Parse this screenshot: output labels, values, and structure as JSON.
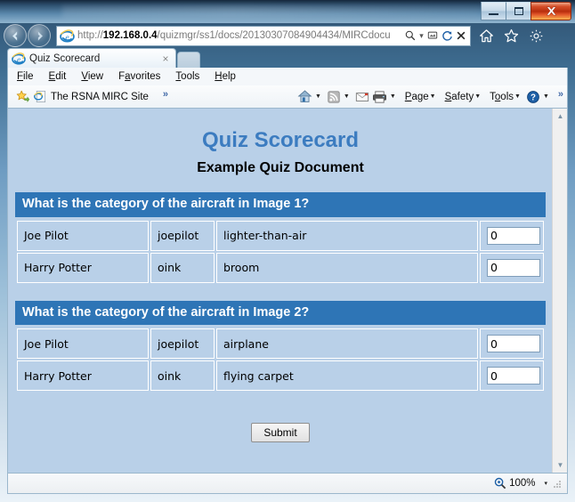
{
  "window": {
    "controls": {
      "minimize": "Minimize",
      "maximize": "Maximize",
      "close": "Close"
    }
  },
  "browser": {
    "back_label": "Back",
    "forward_label": "Forward",
    "address": {
      "scheme": "http://",
      "host": "192.168.0.4",
      "path": "/quizmgr/ss1/docs/20130307084904434/MIRCdocu",
      "full": "http://192.168.0.4/quizmgr/ss1/docs/20130307084904434/MIRCdocu",
      "search_icon": "search-icon",
      "dropdown_icon": "chevron-down-icon",
      "compatibility_icon": "compatibility-view-icon",
      "refresh_icon": "refresh-icon",
      "stop_icon": "stop-icon"
    },
    "nav_right_icons": [
      "home-icon",
      "favorites-star-icon",
      "settings-gear-icon"
    ],
    "tab": {
      "title": "Quiz Scorecard",
      "close_label": "×",
      "new_tab_label": "New Tab"
    },
    "menu": [
      "File",
      "Edit",
      "View",
      "Favorites",
      "Tools",
      "Help"
    ],
    "favorites_bar": {
      "add_icon": "add-favorites-star-icon",
      "site_icon": "ie-page-icon",
      "site_label": "The RSNA MIRC Site",
      "overflow": "»"
    },
    "command_bar": {
      "icons": [
        "home-icon",
        "feeds-icon",
        "mail-icon",
        "print-icon"
      ],
      "menus": [
        "Page",
        "Safety",
        "Tools"
      ],
      "help_icon": "help-question-icon",
      "overflow": "»"
    },
    "status_bar": {
      "zoom_icon": "zoom-magnifier-icon",
      "zoom_level": "100%",
      "zoom_caret": "▾"
    },
    "scrollbar": {
      "up_arrow": "▲",
      "down_arrow": "▼"
    }
  },
  "page": {
    "title": "Quiz Scorecard",
    "subtitle": "Example Quiz Document",
    "colors": {
      "background": "#b9d0e8",
      "title": "#3c7cc0",
      "question_header_bg": "#2e75b6",
      "question_header_text": "#ffffff",
      "cell_border": "#ffffff"
    },
    "questions": [
      {
        "header": "What is the category of the aircraft in Image 1?",
        "rows": [
          {
            "name": "Joe Pilot",
            "username": "joepilot",
            "answer": "lighter-than-air",
            "score": "0"
          },
          {
            "name": "Harry Potter",
            "username": "oink",
            "answer": "broom",
            "score": "0"
          }
        ]
      },
      {
        "header": "What is the category of the aircraft in Image 2?",
        "rows": [
          {
            "name": "Joe Pilot",
            "username": "joepilot",
            "answer": "airplane",
            "score": "0"
          },
          {
            "name": "Harry Potter",
            "username": "oink",
            "answer": "flying carpet",
            "score": "0"
          }
        ]
      }
    ],
    "submit_label": "Submit"
  }
}
